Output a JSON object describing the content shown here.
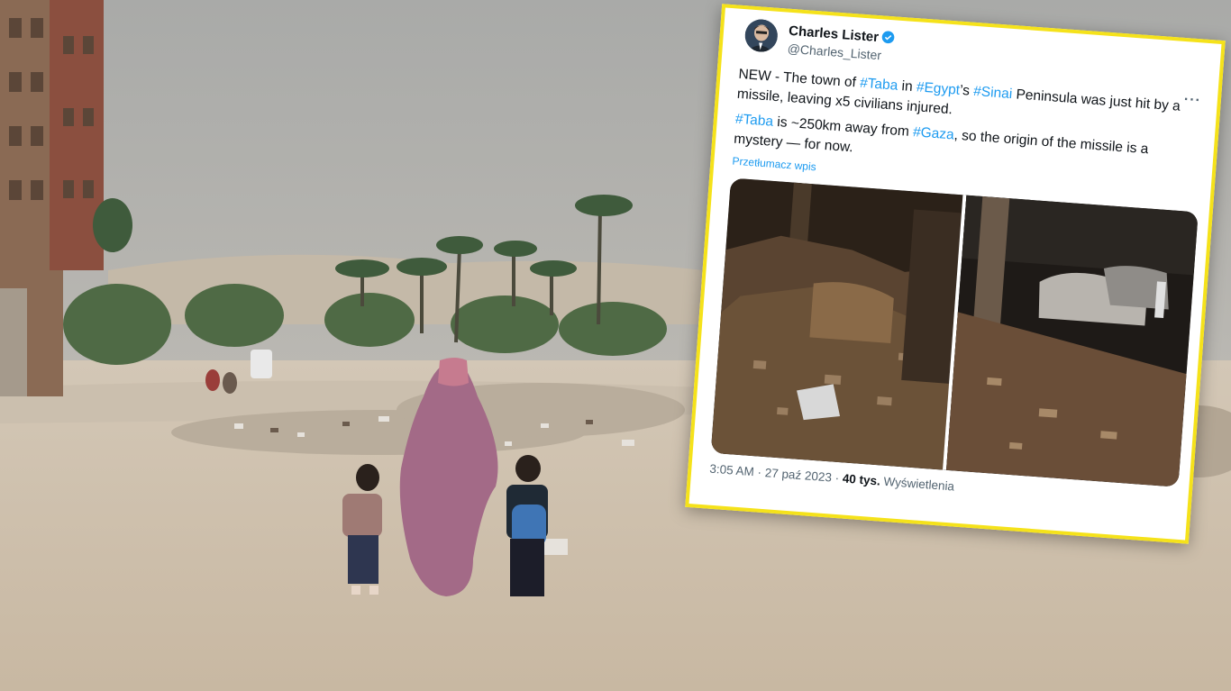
{
  "tweet": {
    "author_name": "Charles Lister",
    "author_handle": "@Charles_Lister",
    "text_parts_1": [
      "NEW - The town of ",
      "#Taba",
      " in ",
      "#Egypt",
      "’s ",
      "#Sinai",
      " Peninsula was just hit by a missile, leaving x5 civilians injured."
    ],
    "text_parts_2": [
      "#Taba",
      " is ~250km away from ",
      "#Gaza",
      ", so the origin of the missile is a mystery — for now."
    ],
    "translate_label": "Przetłumacz wpis",
    "time": "3:05 AM",
    "sep1": " · ",
    "date": "27 paź 2023",
    "sep2": " · ",
    "views_count": "40 tys.",
    "views_label": " Wyświetlenia",
    "icons": [
      "verified-badge-icon",
      "more-options-icon"
    ],
    "colors": {
      "frame": "#f5e21a",
      "link": "#1d9bf0",
      "verified": "#1d9bf0"
    }
  }
}
